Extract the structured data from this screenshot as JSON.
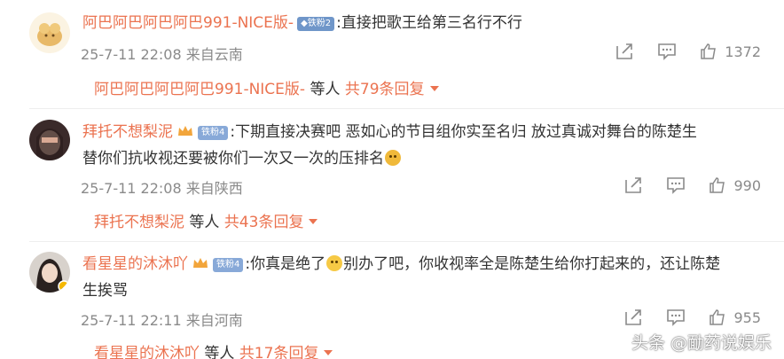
{
  "comments": [
    {
      "username": "阿巴阿巴阿巴阿巴991-NICE版-",
      "badge": "铁粉2",
      "text": ":直接把歌王给第三名行不行",
      "meta": "25-7-11 22:08 来自云南",
      "likes": "1372",
      "sub_user": "阿巴阿巴阿巴阿巴991-NICE版-",
      "sub_others": " 等人 ",
      "sub_more": "共79条回复"
    },
    {
      "username": "拜托不想梨泥",
      "badge": "铁粉4",
      "text_line1": ":下期直接决赛吧  恶如心的节目组你实至名归  放过真诚对舞台的陈楚生",
      "text_line2": "替你们抗收视还要被你们一次又一次的压排名",
      "meta": "25-7-11 22:08 来自陕西",
      "likes": "990",
      "sub_user": "拜托不想梨泥",
      "sub_others": " 等人 ",
      "sub_more": "共43条回复"
    },
    {
      "username": "看星星的沐沐吖",
      "badge": "铁粉4",
      "text_line1a": ":你真是绝了",
      "text_line1b": "别办了吧，你收视率全是陈楚生给你打起来的，还让陈楚",
      "text_line2": "生挨骂",
      "meta": "25-7-11 22:11 来自河南",
      "likes": "955",
      "sub_user": "看星星的沐沐吖",
      "sub_others": " 等人 ",
      "sub_more": "共17条回复"
    }
  ],
  "icons": {
    "share": "share-icon",
    "reply": "comment-icon",
    "like": "thumbs-up-icon",
    "caret": "caret-down-icon"
  },
  "colors": {
    "username": "#eb7350",
    "meta": "#8a8a8a",
    "text": "#333333",
    "badge": "#6f96c9"
  },
  "watermark": "头条 @勔药说娱乐"
}
